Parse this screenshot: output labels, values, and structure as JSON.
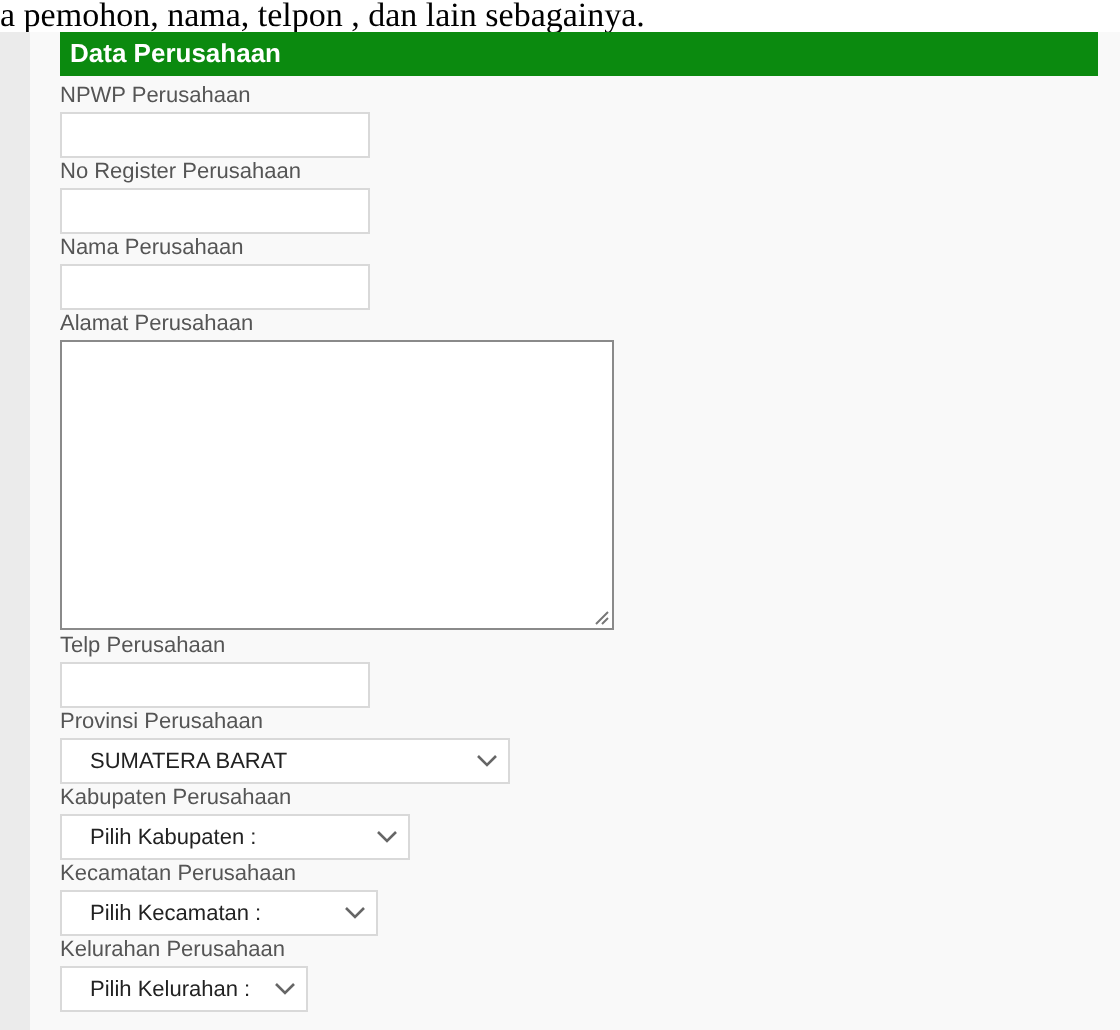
{
  "intro_text": "a pemohon, nama, telpon , dan lain sebagainya.",
  "section": {
    "title": "Data Perusahaan",
    "fields": [
      {
        "kind": "text",
        "label": "NPWP Perusahaan"
      },
      {
        "kind": "text",
        "label": "No Register Perusahaan"
      },
      {
        "kind": "text",
        "label": "Nama Perusahaan"
      },
      {
        "kind": "textarea",
        "label": "Alamat Perusahaan"
      },
      {
        "kind": "text",
        "label": "Telp Perusahaan"
      },
      {
        "kind": "select",
        "label": "Provinsi Perusahaan",
        "value": "SUMATERA BARAT"
      },
      {
        "kind": "select",
        "label": "Kabupaten Perusahaan",
        "value": "Pilih Kabupaten :"
      },
      {
        "kind": "select",
        "label": "Kecamatan Perusahaan",
        "value": "Pilih Kecamatan :"
      },
      {
        "kind": "select",
        "label": "Kelurahan Perusahaan",
        "value": "Pilih Kelurahan :"
      }
    ]
  }
}
